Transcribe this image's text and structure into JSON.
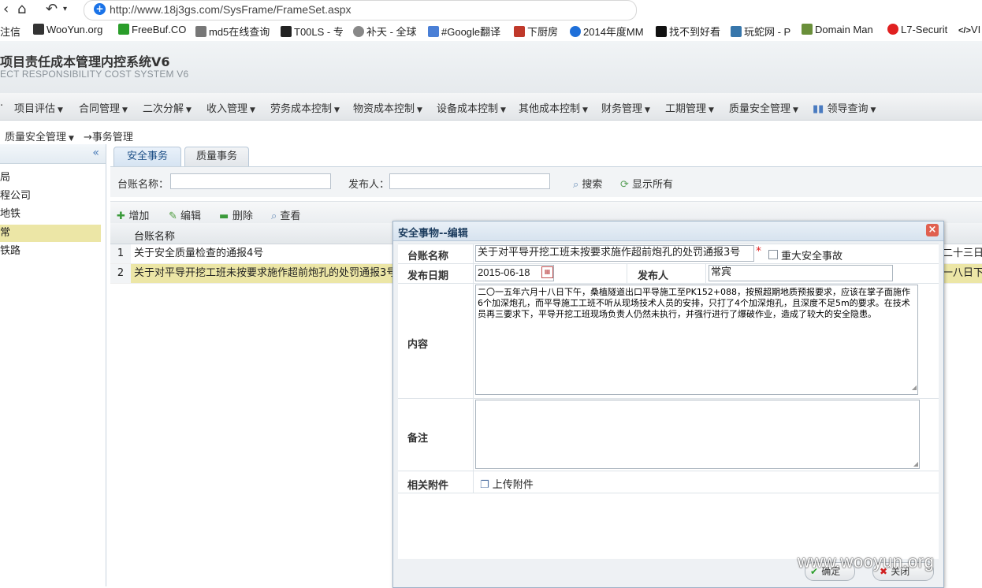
{
  "browser": {
    "url": "http://www.18j3gs.com/SysFrame/FrameSet.aspx",
    "bookmarks": [
      "注信",
      "WooYun.org",
      "FreeBuf.CO",
      "md5在线查询",
      "T00LS - 专",
      "补天 - 全球",
      "#Google翻译",
      "下厨房",
      "2014年度MM",
      "找不到好看",
      "玩蛇网 - P",
      "Domain Man",
      "L7-Securit",
      "VI"
    ]
  },
  "app": {
    "title": "项目责任成本管理内控系统V6",
    "subtitle": "ECT RESPONSIBILITY COST SYSTEM V6"
  },
  "menu": [
    "项目评估",
    "合同管理",
    "二次分解",
    "收入管理",
    "劳务成本控制",
    "物资成本控制",
    "设备成本控制",
    "其他成本控制",
    "财务管理",
    "工期管理",
    "质量安全管理",
    "领导查询"
  ],
  "breadcrumb": {
    "module": "质量安全管理",
    "page": "→事务管理"
  },
  "left_tree": {
    "collapse_icon": "«",
    "items": [
      "局",
      "程公司",
      "地铁",
      "常",
      "铁路"
    ],
    "selected_index": 3
  },
  "tabs": [
    "安全事务",
    "质量事务"
  ],
  "search": {
    "name_label": "台账名称：",
    "publisher_label": "发布人：",
    "search_button": "搜索",
    "show_all_button": "显示所有"
  },
  "toolbar": {
    "add": "增加",
    "edit": "编辑",
    "delete": "删除",
    "view": "查看"
  },
  "grid": {
    "column_header": "台账名称",
    "rows": [
      {
        "num": "1",
        "name": "关于安全质量检查的通报4号",
        "overflow_text": "二十三日,"
      },
      {
        "num": "2",
        "name": "关于对平导开挖工班未按要求施作超前炮孔的处罚通报3号",
        "overflow_text": "一八日下午"
      }
    ]
  },
  "dialog": {
    "title": "安全事物--编辑",
    "fields": {
      "name_label": "台账名称",
      "name_value": "关于对平导开挖工班未按要求施作超前炮孔的处罚通报3号",
      "required_mark": "*",
      "major_accident_label": "重大安全事故",
      "date_label": "发布日期",
      "date_value": "2015-06-18",
      "publisher_label": "发布人",
      "publisher_value": "常宾",
      "content_label": "内容",
      "content_value": "二〇一五年六月十八日下午，桑植隧道出口平导施工至PK152+088，按照超期地质预报要求，应该在掌子面施作6个加深炮孔，而平导施工工班不听从现场技术人员的安排，只打了4个加深炮孔，且深度不足5m的要求。在技术员再三要求下，平导开挖工班现场负责人仍然未执行，并强行进行了爆破作业，造成了较大的安全隐患。",
      "remark_label": "备注",
      "remark_value": "",
      "attachment_label": "相关附件",
      "upload_label": "上传附件"
    },
    "buttons": {
      "ok": "确定",
      "close": "关闭"
    }
  },
  "watermark": "www.wooyun.org"
}
